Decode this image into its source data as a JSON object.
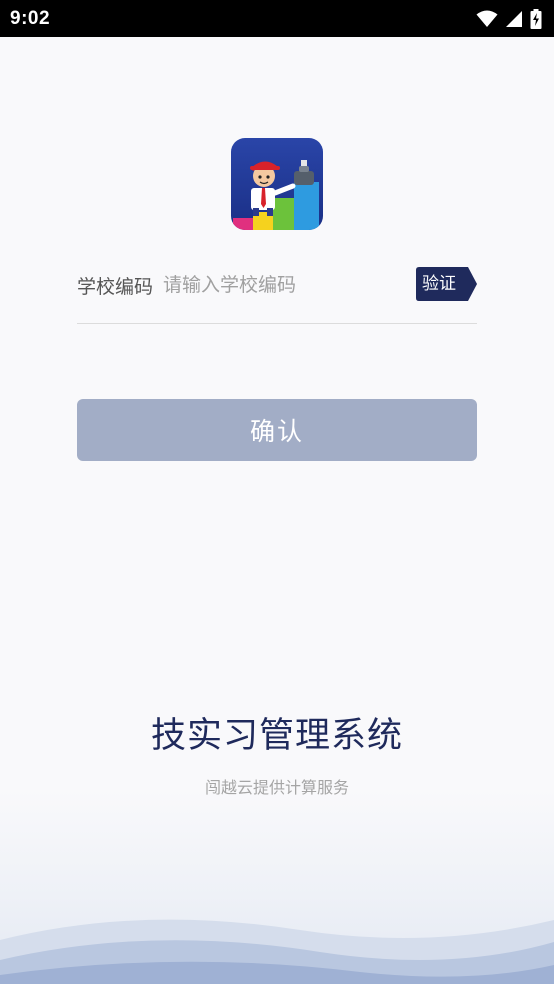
{
  "status_bar": {
    "time": "9:02"
  },
  "logo": {
    "icon": "app-logo-mascot"
  },
  "form": {
    "school_code_label": "学校编码",
    "school_code_placeholder": "请输入学校编码",
    "school_code_value": "",
    "verify_label": "验证",
    "confirm_label": "确认"
  },
  "footer": {
    "app_title": "技实习管理系统",
    "provider": "闯越云提供计算服务"
  },
  "colors": {
    "accent": "#1f2a5c",
    "confirm_disabled": "#a2adc6",
    "verify_badge": "#1f2a5c"
  }
}
